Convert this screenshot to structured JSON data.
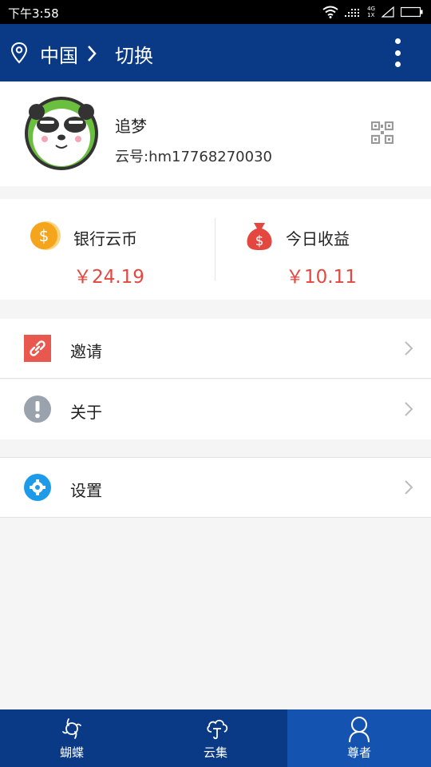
{
  "status_bar": {
    "time": "下午3:58",
    "network_top": "4G",
    "network_bottom": "1X"
  },
  "app_bar": {
    "location": "中国",
    "switch_label": "切换"
  },
  "profile": {
    "name": "追梦",
    "user_id": "云号:hm17768270030"
  },
  "stats": {
    "coins_label": "银行云币",
    "coins_value": "￥24.19",
    "earnings_label": "今日收益",
    "earnings_value": "￥10.11",
    "value_color": "#e3473f"
  },
  "menu": [
    {
      "label": "邀请",
      "icon": "link-icon"
    },
    {
      "label": "关于",
      "icon": "info-icon"
    },
    {
      "label": "设置",
      "icon": "settings-icon"
    }
  ],
  "bottom_nav": [
    {
      "label": "蝴蝶",
      "icon": "butterfly-icon",
      "active": false
    },
    {
      "label": "云集",
      "icon": "cloud-icon",
      "active": false
    },
    {
      "label": "尊者",
      "icon": "person-icon",
      "active": true
    }
  ],
  "colors": {
    "primary": "#0a3a86",
    "active_tab": "#1453b0",
    "accent_red": "#e3473f",
    "coin_orange": "#f5a51c"
  }
}
